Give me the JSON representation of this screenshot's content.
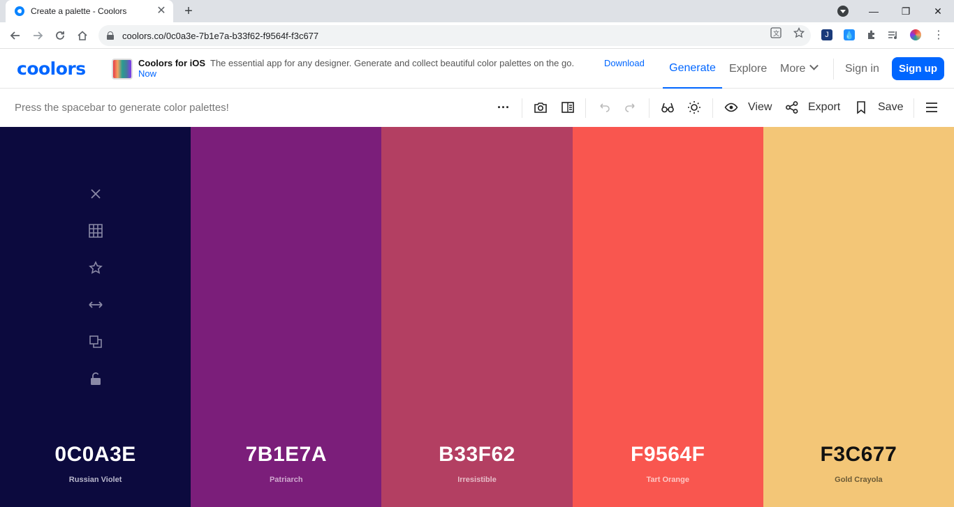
{
  "browser": {
    "tab_title": "Create a palette - Coolors",
    "tab_close": "✕",
    "new_tab": "+",
    "url": "coolors.co/0c0a3e-7b1e7a-b33f62-f9564f-f3c677",
    "window_controls": {
      "minimize": "—",
      "maximize": "❐",
      "close": "✕"
    }
  },
  "header": {
    "logo": "coolors",
    "promo_title": "Coolors for iOS",
    "promo_text": "The essential app for any designer. Generate and collect beautiful color palettes on the go.",
    "promo_link_1": "Download",
    "promo_link_2": "Now",
    "nav": {
      "generate": "Generate",
      "explore": "Explore",
      "more": "More",
      "signin": "Sign in",
      "signup": "Sign up"
    }
  },
  "toolbar": {
    "hint": "Press the spacebar to generate color palettes!",
    "more": "···",
    "view_label": "View",
    "export_label": "Export",
    "save_label": "Save"
  },
  "palette": {
    "colors": [
      {
        "hex": "0C0A3E",
        "name": "Russian Violet",
        "bg": "#0c0a3e",
        "fg": "#ffffff",
        "sub": "#b9b8cc"
      },
      {
        "hex": "7B1E7A",
        "name": "Patriarch",
        "bg": "#7b1e7a",
        "fg": "#ffffff",
        "sub": "#d0a9cf"
      },
      {
        "hex": "B33F62",
        "name": "Irresistible",
        "bg": "#b33f62",
        "fg": "#ffffff",
        "sub": "#e6bcc8"
      },
      {
        "hex": "F9564F",
        "name": "Tart Orange",
        "bg": "#f9564f",
        "fg": "#ffffff",
        "sub": "#fdc6c3"
      },
      {
        "hex": "F3C677",
        "name": "Gold Crayola",
        "bg": "#f3c677",
        "fg": "#111111",
        "sub": "#6b5a36"
      }
    ]
  },
  "colors": {
    "accent": "#0066ff",
    "tool_icon": "#8a89a6"
  }
}
